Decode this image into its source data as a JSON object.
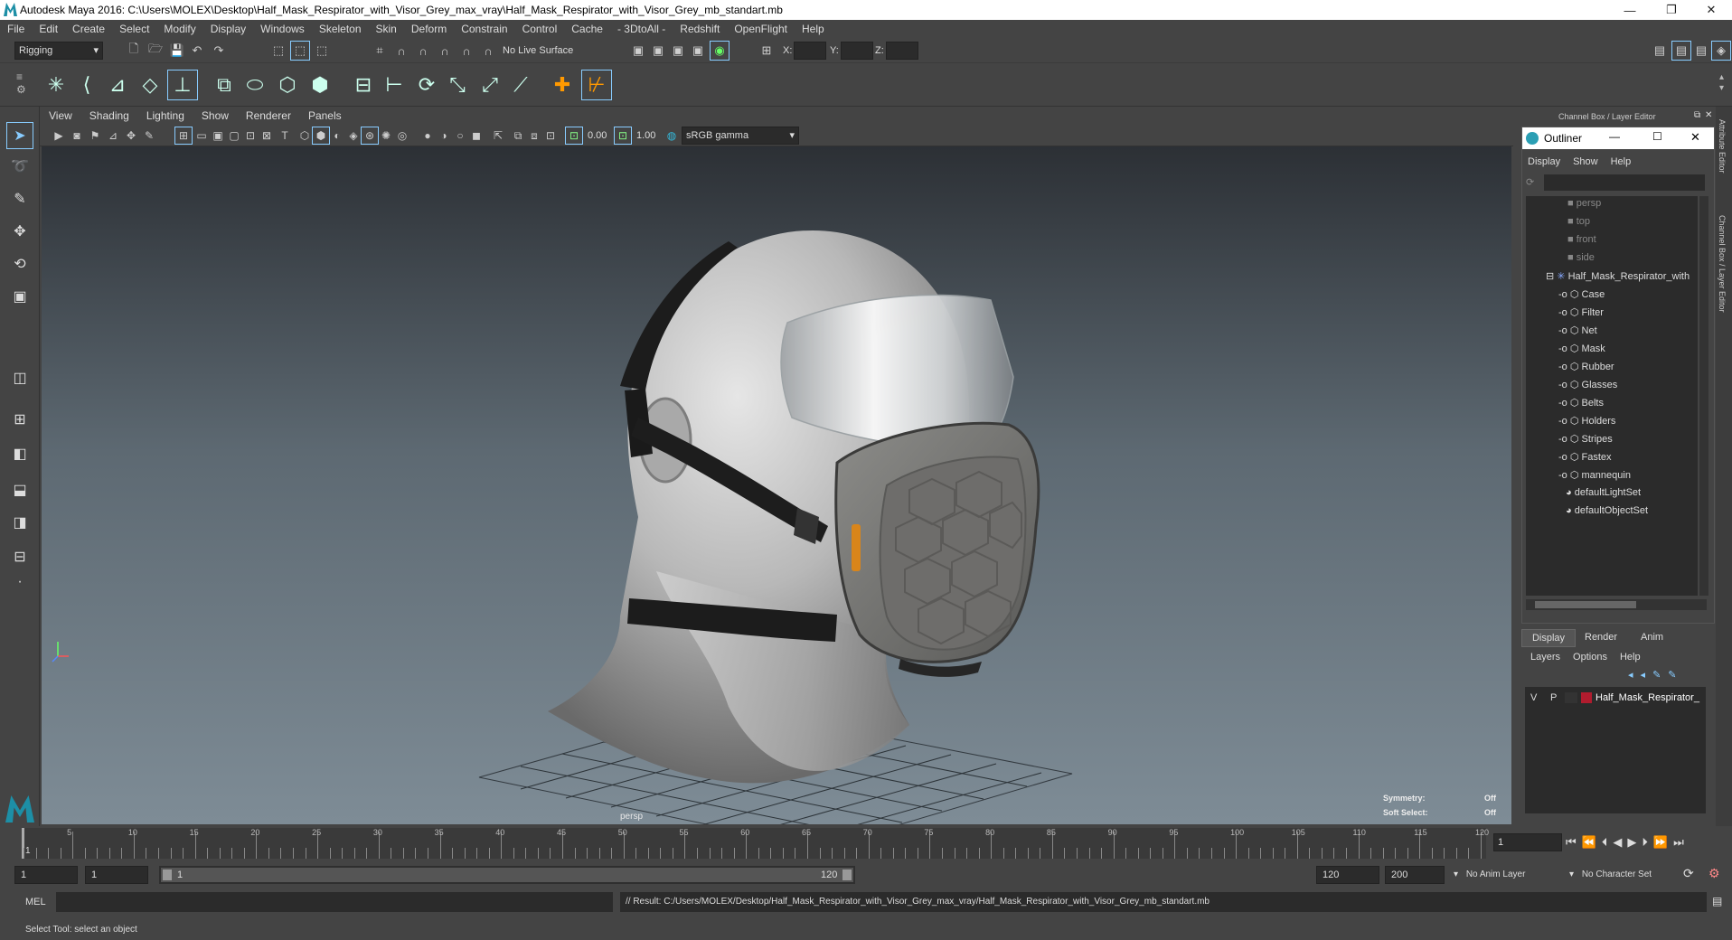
{
  "window": {
    "title": "Autodesk Maya 2016: C:\\Users\\MOLEX\\Desktop\\Half_Mask_Respirator_with_Visor_Grey_max_vray\\Half_Mask_Respirator_with_Visor_Grey_mb_standart.mb"
  },
  "menu": [
    "File",
    "Edit",
    "Create",
    "Select",
    "Modify",
    "Display",
    "Windows",
    "Skeleton",
    "Skin",
    "Deform",
    "Constrain",
    "Control",
    "Cache",
    "- 3DtoAll -",
    "Redshift",
    "OpenFlight",
    "Help"
  ],
  "status": {
    "mode": "Rigging",
    "live_surface": "No Live Surface",
    "x_label": "X:",
    "y_label": "Y:",
    "z_label": "Z:"
  },
  "viewport": {
    "menu": [
      "View",
      "Shading",
      "Lighting",
      "Show",
      "Renderer",
      "Panels"
    ],
    "exposure": "0.00",
    "gamma": "1.00",
    "color_space": "sRGB gamma",
    "camera_label": "persp",
    "symmetry_label": "Symmetry:",
    "symmetry_value": "Off",
    "soft_select_label": "Soft Select:",
    "soft_select_value": "Off"
  },
  "right_panel": {
    "header": "Channel Box / Layer Editor",
    "side_tabs": [
      "Attribute Editor",
      "Channel Box / Layer Editor"
    ],
    "outliner": {
      "title": "Outliner",
      "menu": [
        "Display",
        "Show",
        "Help"
      ],
      "cameras": [
        "persp",
        "top",
        "front",
        "side"
      ],
      "group": "Half_Mask_Respirator_with",
      "children": [
        "Case",
        "Filter",
        "Net",
        "Mask",
        "Rubber",
        "Glasses",
        "Belts",
        "Holders",
        "Stripes",
        "Fastex",
        "mannequin"
      ],
      "sets": [
        "defaultLightSet",
        "defaultObjectSet"
      ]
    },
    "layer_tabs": [
      "Display",
      "Render",
      "Anim"
    ],
    "layer_menu": [
      "Layers",
      "Options",
      "Help"
    ],
    "layer": {
      "v": "V",
      "p": "P",
      "name": "Half_Mask_Respirator_",
      "color": "#b01c2e"
    }
  },
  "timeline": {
    "ticks": [
      "5",
      "10",
      "15",
      "20",
      "25",
      "30",
      "35",
      "40",
      "45",
      "50",
      "55",
      "60",
      "65",
      "70",
      "75",
      "80",
      "85",
      "90",
      "95",
      "100",
      "105",
      "110",
      "115",
      "120"
    ],
    "current_frame": "1",
    "first_tick": "1"
  },
  "range": {
    "start": "1",
    "anim_start": "1",
    "slider_start": "1",
    "slider_end": "120",
    "end": "120",
    "anim_end": "200",
    "anim_layer": "No Anim Layer",
    "character_set": "No Character Set"
  },
  "command": {
    "label": "MEL",
    "result": "// Result: C:/Users/MOLEX/Desktop/Half_Mask_Respirator_with_Visor_Grey_max_vray/Half_Mask_Respirator_with_Visor_Grey_mb_standart.mb"
  },
  "help_line": "Select Tool: select an object"
}
